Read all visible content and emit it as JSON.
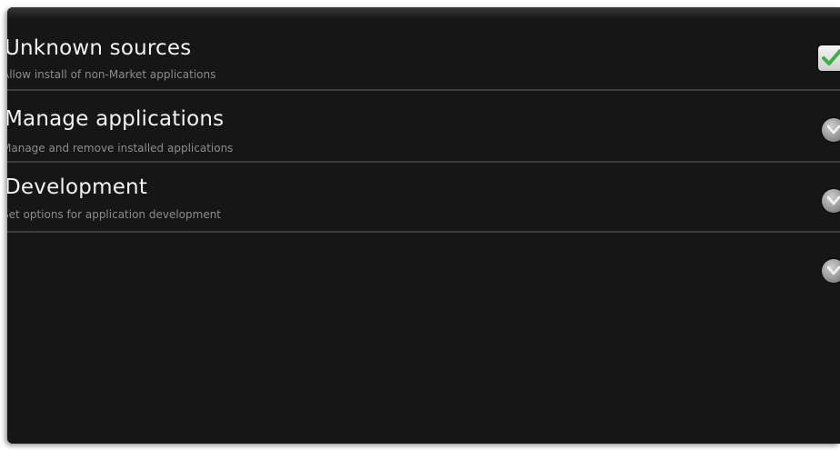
{
  "settings": {
    "items": [
      {
        "title": "Unknown sources",
        "summary": "Allow install of non-Market applications",
        "control": "checkbox",
        "checked": true,
        "icon": "checkmark-icon"
      },
      {
        "title": "Manage applications",
        "summary": "Manage and remove installed applications",
        "control": "chevron",
        "icon": "chevron-down-icon"
      },
      {
        "title": "Development",
        "summary": "Set options for application development",
        "control": "chevron",
        "icon": "chevron-down-icon"
      },
      {
        "title": "",
        "summary": "",
        "control": "chevron",
        "icon": "chevron-down-icon"
      }
    ]
  },
  "colors": {
    "background": "#161616",
    "title_text": "#f2f2f2",
    "summary_text": "#8c8c8c",
    "check_green": "#3cb043",
    "divider": "#3c3c3c"
  }
}
